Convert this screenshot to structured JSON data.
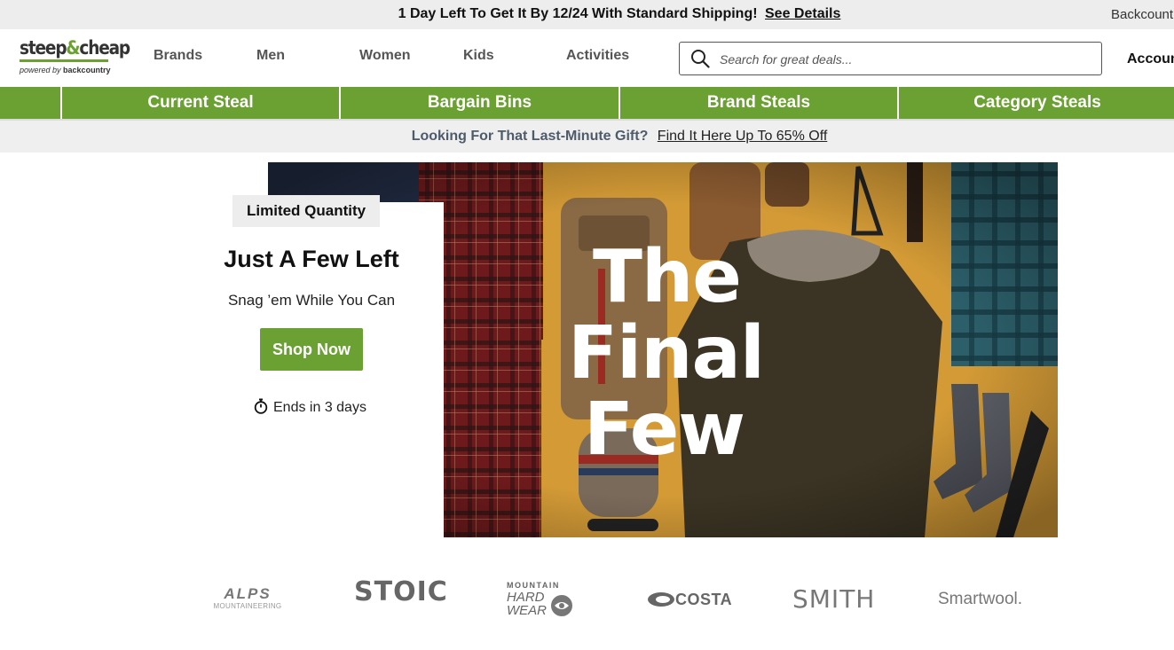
{
  "topbar": {
    "message": "1 Day Left To Get It By 12/24 With Standard Shipping!",
    "link": "See Details",
    "backcountry": "Backcountry"
  },
  "header": {
    "logo_main_left": "steep",
    "logo_amp": "&",
    "logo_main_right": "cheap",
    "logo_powered": "powered by",
    "logo_powered_brand": "backcountry",
    "nav": [
      "Brands",
      "Men",
      "Women",
      "Kids",
      "Activities"
    ],
    "search_placeholder": "Search for great deals...",
    "account": "Account"
  },
  "green_nav": [
    "Current Steal",
    "Bargain Bins",
    "Brand Steals",
    "Category Steals"
  ],
  "promo": {
    "text": "Looking For That Last-Minute Gift?",
    "link": "Find It Here Up To 65% Off"
  },
  "hero": {
    "badge": "Limited Quantity",
    "title": "Just A Few Left",
    "subtitle": "Snag ’em While You Can",
    "button": "Shop Now",
    "ends": "Ends in 3 days",
    "image_title_line1": "The",
    "image_title_line2": "Final",
    "image_title_line3": "Few"
  },
  "brands": {
    "alps_main": "ALPS",
    "alps_sub": "MOUNTAINEERING",
    "stoic": "STOIC",
    "mhw_top": "MOUNTAIN",
    "mhw_mid": "HARD",
    "mhw_bot": "WEAR",
    "costa": "COSTA",
    "smith": "SMITH",
    "smartwool": "Smartwool."
  },
  "colors": {
    "brand_green": "#6ba033",
    "topbar_bg": "#ededed",
    "promo_text": "#4e5b6a"
  }
}
